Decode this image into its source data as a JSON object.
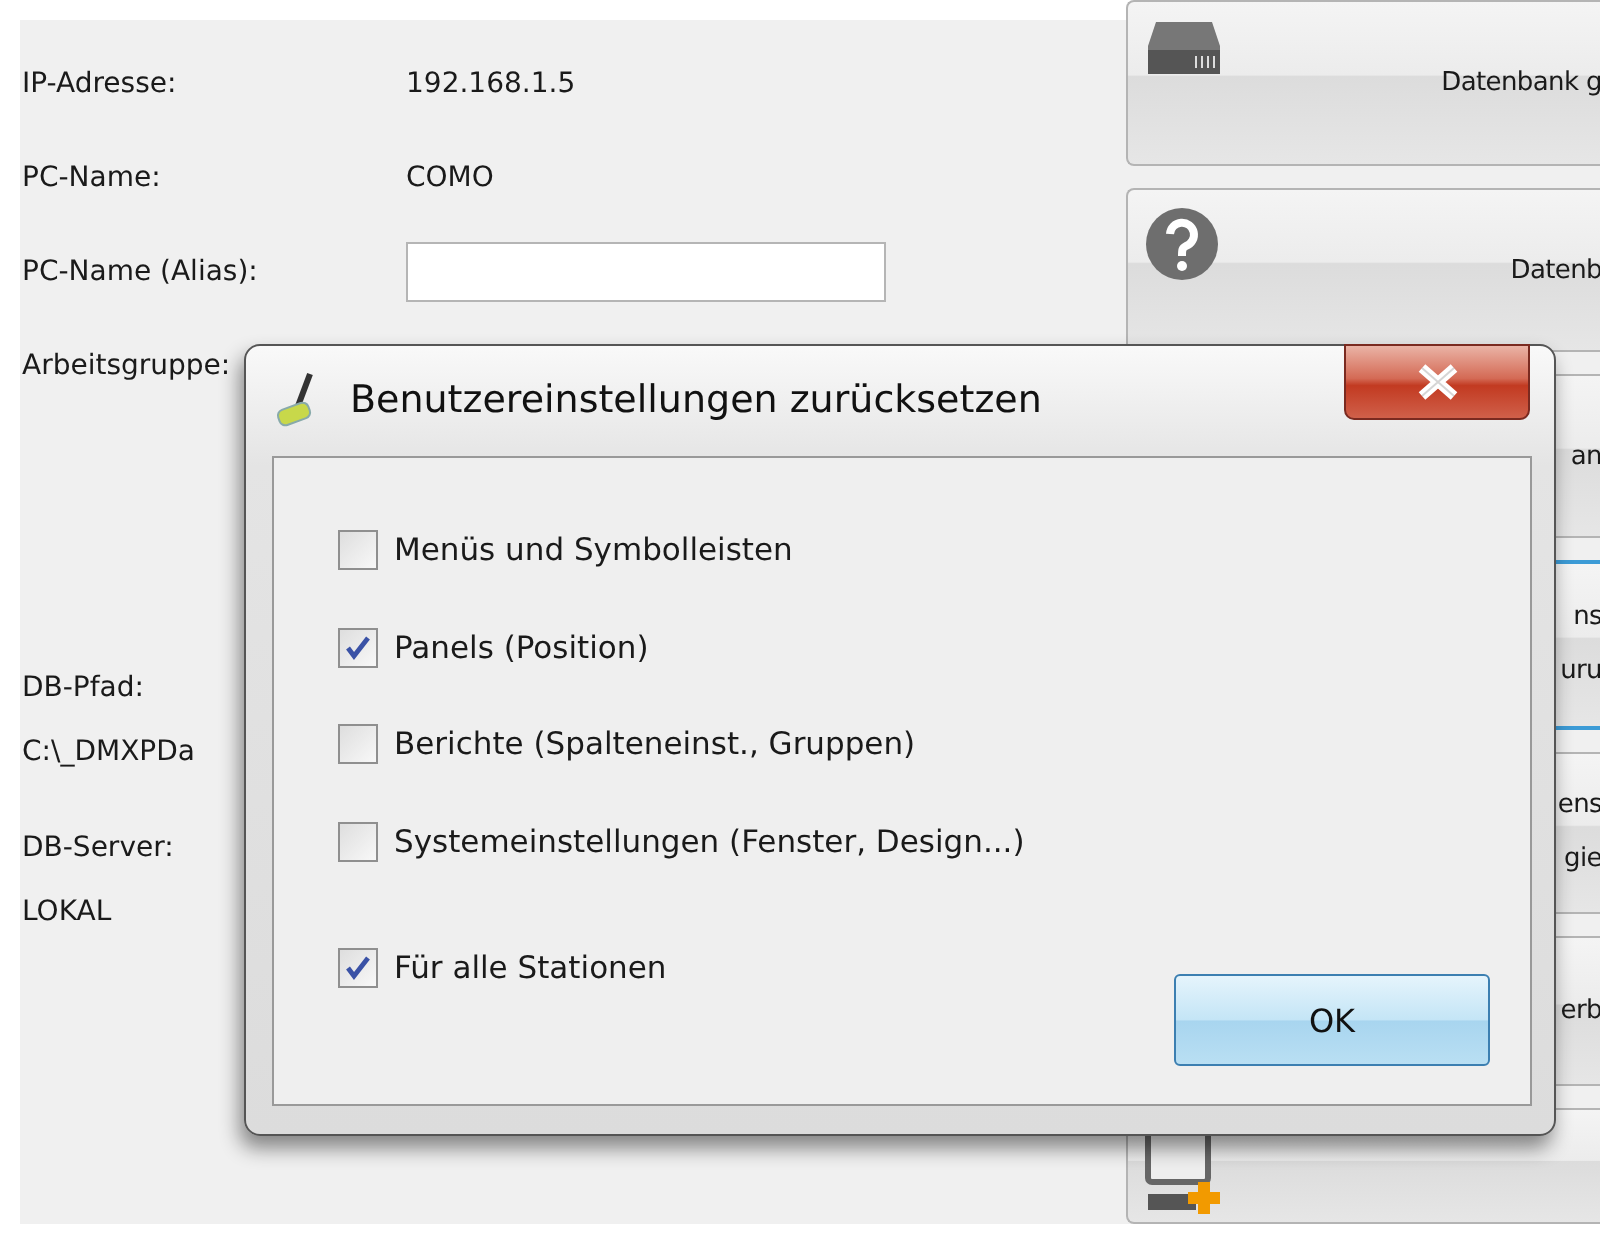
{
  "info": [
    {
      "label": "IP-Adresse:",
      "kind": "text",
      "value": "192.168.1.5"
    },
    {
      "label": "PC-Name:",
      "kind": "text",
      "value": "COMO"
    },
    {
      "label": "PC-Name (Alias):",
      "kind": "field"
    },
    {
      "label": "Arbeitsgruppe:",
      "kind": "label"
    }
  ],
  "db": [
    {
      "label": "DB-Pfad:",
      "value": "C:\\_DMXPDa"
    },
    {
      "label": "DB-Server:",
      "value": "LOKAL"
    }
  ],
  "side_buttons": [
    {
      "kind": "server",
      "lines": [
        "Datenbank g"
      ]
    },
    {
      "kind": "help",
      "lines": [
        "Datenb"
      ]
    },
    {
      "kind": "plain",
      "lines": [
        "an"
      ]
    },
    {
      "kind": "focused",
      "lines": [
        "ns",
        "uru"
      ]
    },
    {
      "kind": "plain",
      "lines": [
        "ens",
        "gie"
      ]
    },
    {
      "kind": "plain",
      "lines": [
        "erb"
      ]
    },
    {
      "kind": "add-computer"
    }
  ],
  "dialog": {
    "title": "Benutzereinstellungen zurücksetzen",
    "options": [
      {
        "label": "Menüs und Symbolleisten",
        "checked": false
      },
      {
        "label": "Panels (Position)",
        "checked": true
      },
      {
        "label": "Berichte (Spalteneinst., Gruppen)",
        "checked": false
      },
      {
        "label": "Systemeinstellungen (Fenster, Design...)",
        "checked": false
      }
    ],
    "all_stations": {
      "label": "Für alle Stationen",
      "checked": true
    },
    "ok": "OK"
  }
}
